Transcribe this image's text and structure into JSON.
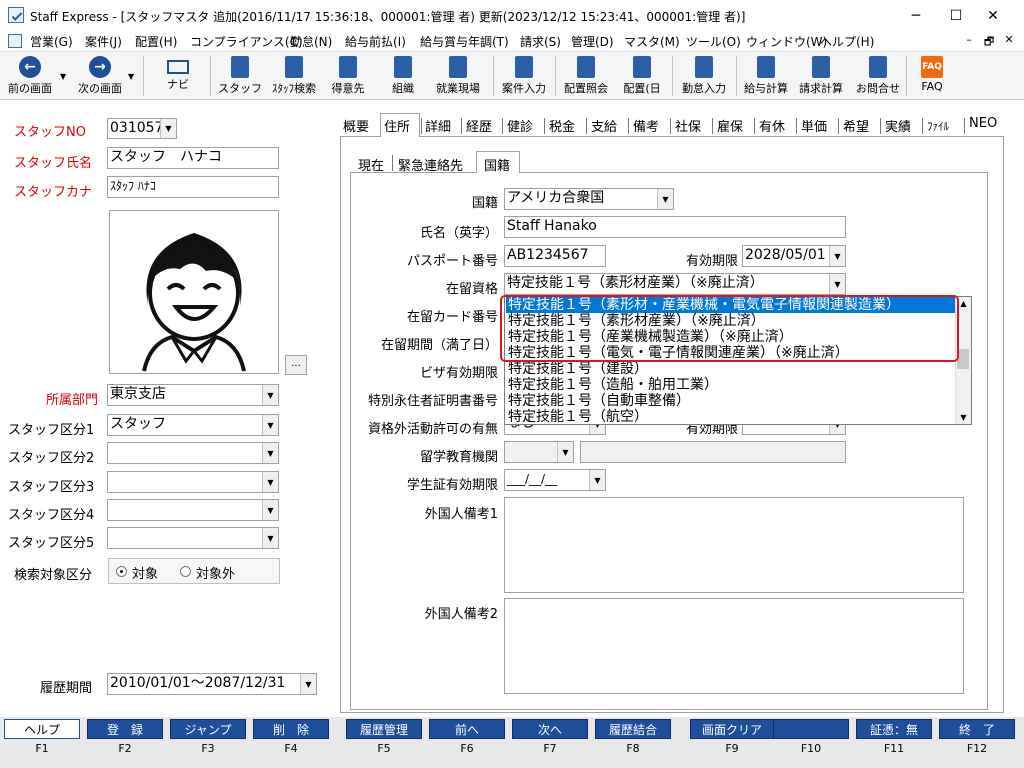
{
  "window": {
    "title": "Staff Express - [スタッフマスタ 追加(2016/11/17 15:36:18、000001:管理 者) 更新(2023/12/12 15:23:41、000001:管理 者)]",
    "minimize": "─",
    "maximize": "☐",
    "close": "✕"
  },
  "menu": {
    "items": [
      "営業(G)",
      "案件(J)",
      "配置(H)",
      "コンプライアンス(C)",
      "勤怠(N)",
      "給与前払(I)",
      "給与賞与年調(T)",
      "請求(S)",
      "管理(D)",
      "マスタ(M)",
      "ツール(O)",
      "ウィンドウ(W)",
      "ヘルプ(H)"
    ],
    "mdi_min": "–",
    "mdi_restore": "🗗",
    "mdi_close": "✕"
  },
  "toolbar": {
    "prev": "前の画面",
    "next": "次の画面",
    "navi": "ナビ",
    "staff": "スタッフ",
    "staff_search": "ｽﾀｯﾌ検索",
    "customer": "得意先",
    "org": "組織",
    "worksite": "就業現場",
    "job_entry": "案件入力",
    "placement_inq": "配置照会",
    "placement_day": "配置(日",
    "attendance": "勤怠入力",
    "payroll": "給与計算",
    "billing": "請求計算",
    "contact": "お問合せ",
    "faq": "FAQ",
    "faq_badge": "FAQ"
  },
  "left": {
    "staff_no_label": "スタッフNO",
    "staff_no": "031057",
    "name_label": "スタッフ氏名",
    "name": "スタッフ　ハナコ",
    "kana_label": "スタッフカナ",
    "kana": "ｽﾀｯﾌ ﾊﾅｺ",
    "photo_btn": "...",
    "dept_label": "所属部門",
    "dept": "東京支店",
    "cat1_label": "スタッフ区分1",
    "cat1": "スタッフ",
    "cat2_label": "スタッフ区分2",
    "cat3_label": "スタッフ区分3",
    "cat4_label": "スタッフ区分4",
    "cat5_label": "スタッフ区分5",
    "search_label": "検索対象区分",
    "search_on": "対象",
    "search_off": "対象外",
    "history_label": "履歴期間",
    "history": "2010/01/01～2087/12/31"
  },
  "tabs": [
    "概要",
    "住所",
    "詳細",
    "経歴",
    "健診",
    "税金",
    "支給",
    "備考",
    "社保",
    "雇保",
    "有休",
    "単価",
    "希望",
    "実績",
    "ﾌｧｲﾙ",
    "NEO"
  ],
  "subtabs": [
    "現在",
    "緊急連絡先",
    "国籍"
  ],
  "form": {
    "nationality_label": "国籍",
    "nationality": "アメリカ合衆国",
    "name_en_label": "氏名（英字）",
    "name_en": "Staff Hanako",
    "passport_label": "パスポート番号",
    "passport": "AB1234567",
    "expiry_label": "有効期限",
    "expiry": "2028/05/01",
    "status_label": "在留資格",
    "status": "特定技能１号（素形材産業）（※廃止済）",
    "card_label": "在留カード番号",
    "period_label": "在留期間（満了日）",
    "visa_label": "ビザ有効期限",
    "perm_label": "特別永住者証明書番号",
    "outside_label": "資格外活動許可の有無",
    "outside_val": "なし",
    "outside_expiry_label": "有効期限",
    "school_label": "留学教育機関",
    "student_label": "学生証有効期限",
    "student_date": "___/__/__",
    "note1_label": "外国人備考1",
    "note2_label": "外国人備考2"
  },
  "dropdown": {
    "items": [
      "特定技能１号（素形材・産業機械・電気電子情報関連製造業）",
      "特定技能１号（素形材産業）（※廃止済）",
      "特定技能１号（産業機械製造業）（※廃止済）",
      "特定技能１号（電気・電子情報関連産業）（※廃止済）",
      "特定技能１号（建設）",
      "特定技能１号（造船・舶用工業）",
      "特定技能１号（自動車整備）",
      "特定技能１号（航空）"
    ],
    "selected_index": 0
  },
  "fkeys": [
    {
      "label": "ヘルプ",
      "key": "F1"
    },
    {
      "label": "登　録",
      "key": "F2"
    },
    {
      "label": "ジャンプ",
      "key": "F3"
    },
    {
      "label": "削　除",
      "key": "F4"
    },
    {
      "label": "履歴管理",
      "key": "F5"
    },
    {
      "label": "前へ",
      "key": "F6"
    },
    {
      "label": "次へ",
      "key": "F7"
    },
    {
      "label": "履歴結合",
      "key": "F8"
    },
    {
      "label": "画面クリア",
      "key": "F9"
    },
    {
      "label": "",
      "key": "F10"
    },
    {
      "label": "証憑：無",
      "key": "F11"
    },
    {
      "label": "終　了",
      "key": "F12"
    }
  ],
  "colors": {
    "accent": "#1f4e9b",
    "selected": "#0078d7",
    "highlight": "#e0141e",
    "required_label": "#e00000"
  }
}
